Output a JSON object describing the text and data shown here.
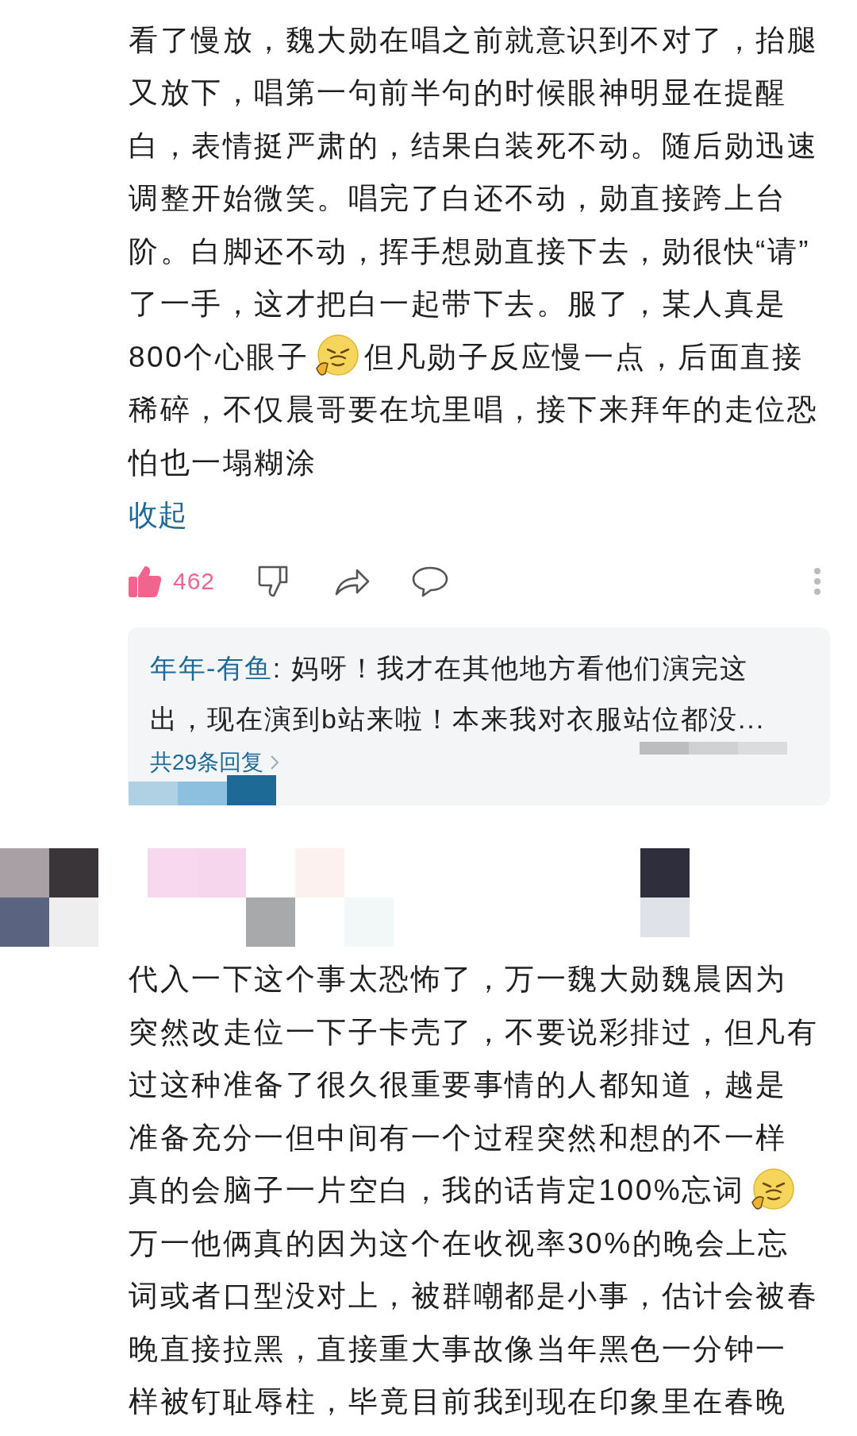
{
  "comments": [
    {
      "lines": [
        [
          {
            "kind": "text",
            "text": "看了慢放，魏大勋在唱之前就意识到不对了，抬腿"
          }
        ],
        [
          {
            "kind": "text",
            "text": "又放下，唱第一句前半句的时候眼神明显在提醒"
          }
        ],
        [
          {
            "kind": "text",
            "text": "白，表情挺严肃的，结果白装死不动。随后勋迅速"
          }
        ],
        [
          {
            "kind": "text",
            "text": "调整开始微笑。唱完了白还不动，勋直接跨上台"
          }
        ],
        [
          {
            "kind": "text",
            "text": "阶。白脚还不动，挥手想勋直接下去，勋很快“请”"
          }
        ],
        [
          {
            "kind": "text",
            "text": "了一手，这才把白一起带下去。服了，某人真是"
          }
        ],
        [
          {
            "kind": "text",
            "text": "800个心眼子"
          },
          {
            "kind": "sticker"
          },
          {
            "kind": "text",
            "text": "但凡勋子反应慢一点，后面直接"
          }
        ],
        [
          {
            "kind": "text",
            "text": "稀碎，不仅晨哥要在坑里唱，接下来拜年的走位恐"
          }
        ],
        [
          {
            "kind": "text",
            "text": "怕也一塌糊涂"
          }
        ]
      ],
      "collapse_link": "收起",
      "like_count": "462",
      "liked": true,
      "reply_preview": {
        "author": "年年-有鱼",
        "lines": [
          ": 妈呀！我才在其他地方看他们演完这",
          "出，现在演到b站来啦！本来我对衣服站位都没..."
        ],
        "more_link": "共29条回复"
      }
    },
    {
      "lines": [
        [
          {
            "kind": "text",
            "text": "代入一下这个事太恐怖了，万一魏大勋魏晨因为"
          }
        ],
        [
          {
            "kind": "text",
            "text": "突然改走位一下子卡壳了，不要说彩排过，但凡有"
          }
        ],
        [
          {
            "kind": "text",
            "text": "过这种准备了很久很重要事情的人都知道，越是"
          }
        ],
        [
          {
            "kind": "text",
            "text": "准备充分一但中间有一个过程突然和想的不一样"
          }
        ],
        [
          {
            "kind": "text",
            "text": "真的会脑子一片空白，我的话肯定100%忘词"
          },
          {
            "kind": "sticker"
          }
        ],
        [
          {
            "kind": "text",
            "text": "万一他俩真的因为这个在收视率30%的晚会上忘"
          }
        ],
        [
          {
            "kind": "text",
            "text": "词或者口型没对上，被群嘲都是小事，估计会被春"
          }
        ],
        [
          {
            "kind": "text",
            "text": "晚直接拉黑，直接重大事故像当年黑色一分钟一"
          }
        ],
        [
          {
            "kind": "text",
            "text": "样被钉耻辱柱，毕竟目前我到现在印象里在春晚"
          }
        ]
      ]
    }
  ]
}
